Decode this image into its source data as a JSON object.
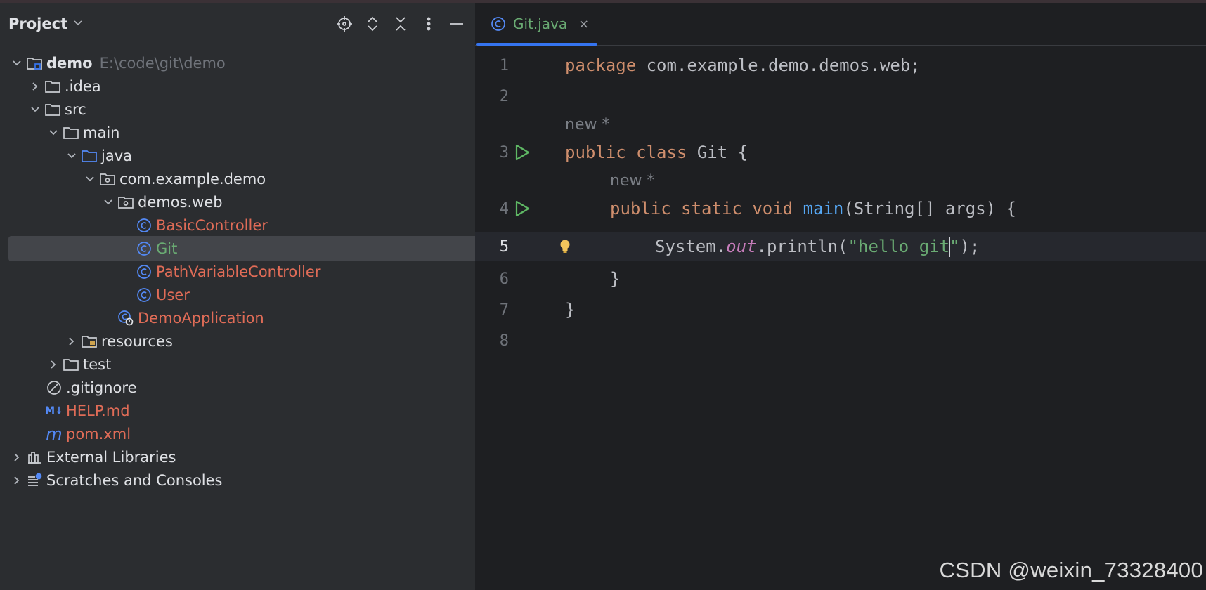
{
  "project_panel": {
    "title": "Project",
    "tree": [
      {
        "label": "demo",
        "path": "E:\\code\\git\\demo"
      },
      {
        "label": ".idea"
      },
      {
        "label": "src"
      },
      {
        "label": "main"
      },
      {
        "label": "java"
      },
      {
        "label": "com.example.demo"
      },
      {
        "label": "demos.web"
      },
      {
        "label": "BasicController"
      },
      {
        "label": "Git"
      },
      {
        "label": "PathVariableController"
      },
      {
        "label": "User"
      },
      {
        "label": "DemoApplication"
      },
      {
        "label": "resources"
      },
      {
        "label": "test"
      },
      {
        "label": ".gitignore"
      },
      {
        "label": "HELP.md",
        "icon_text": "M↓"
      },
      {
        "label": "pom.xml",
        "icon_text": "m"
      },
      {
        "label": "External Libraries"
      },
      {
        "label": "Scratches and Consoles"
      }
    ]
  },
  "editor": {
    "tab": {
      "label": "Git.java",
      "close": "×"
    },
    "line_numbers": [
      "1",
      "2",
      "3",
      "4",
      "5",
      "6",
      "7",
      "8"
    ],
    "code": {
      "l1_kw": "package",
      "l1_rest": " com.example.demo.demos.web;",
      "hint1": "new *",
      "l3_kw1": "public",
      "l3_kw2": "class",
      "l3_rest": " Git {",
      "hint2": "new *",
      "l4_kw1": "public",
      "l4_kw2": "static",
      "l4_kw3": "void",
      "l4_fn": "main",
      "l4_rest": "(String[] args) {",
      "l5_a": "System.",
      "l5_out": "out",
      "l5_b": ".println(",
      "l5_str_a": "\"hello git",
      "l5_str_b": "\"",
      "l5_end": ");",
      "l6": "}",
      "l7": "}"
    }
  },
  "watermark": "CSDN @weixin_73328400",
  "colors": {
    "accent": "#3574f0",
    "keyword": "#cf8e6d",
    "string": "#6aab73",
    "method": "#56a8f5",
    "modified_file": "#e06c57"
  }
}
